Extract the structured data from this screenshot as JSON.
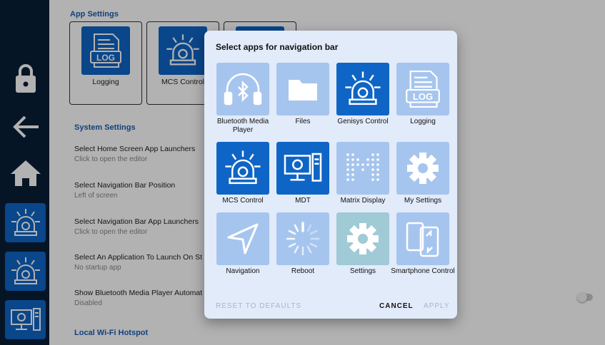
{
  "navbar": {
    "items": [
      {
        "name": "lock",
        "icon": "lock-icon"
      },
      {
        "name": "back",
        "icon": "arrow-left-icon"
      },
      {
        "name": "home",
        "icon": "home-icon"
      },
      {
        "name": "app-1",
        "icon": "beacon-icon"
      },
      {
        "name": "app-2",
        "icon": "beacon-icon"
      },
      {
        "name": "app-3",
        "icon": "computer-icon"
      }
    ]
  },
  "page": {
    "app_settings_header": "App Settings",
    "tiles": [
      {
        "label": "Logging",
        "icon": "log-icon"
      },
      {
        "label": "MCS Control",
        "icon": "beacon-icon"
      }
    ],
    "system_settings_header": "System Settings",
    "settings": [
      {
        "title": "Select Home Screen App Launchers",
        "subtitle": "Click to open the editor"
      },
      {
        "title": "Select Navigation Bar Position",
        "subtitle": "Left of screen"
      },
      {
        "title": "Select Navigation Bar App Launchers",
        "subtitle": "Click to open the editor"
      },
      {
        "title": "Select An Application To Launch On St",
        "subtitle": "No startup app"
      },
      {
        "title": "Show Bluetooth Media Player Automat",
        "subtitle": "Disabled"
      }
    ],
    "wifi_header": "Local Wi-Fi Hotspot"
  },
  "dialog": {
    "title": "Select apps for navigation bar",
    "apps": [
      {
        "label": "Bluetooth Media Player",
        "icon": "bluetooth-headphones-icon",
        "selected": false
      },
      {
        "label": "Files",
        "icon": "folder-icon",
        "selected": false
      },
      {
        "label": "Genisys Control",
        "icon": "beacon-icon",
        "selected": true
      },
      {
        "label": "Logging",
        "icon": "log-icon",
        "selected": false
      },
      {
        "label": "MCS Control",
        "icon": "beacon-icon",
        "selected": true
      },
      {
        "label": "MDT",
        "icon": "computer-icon",
        "selected": true
      },
      {
        "label": "Matrix Display",
        "icon": "matrix-dots-icon",
        "selected": false
      },
      {
        "label": "My Settings",
        "icon": "gear-icon",
        "selected": false
      },
      {
        "label": "Navigation",
        "icon": "navigation-arrow-icon",
        "selected": false
      },
      {
        "label": "Reboot",
        "icon": "reboot-spinner-icon",
        "selected": false
      },
      {
        "label": "Settings",
        "icon": "gear-icon",
        "selected": false
      },
      {
        "label": "Smartphone Control",
        "icon": "smartphone-icon",
        "selected": false
      }
    ],
    "reset_label": "RESET TO DEFAULTS",
    "cancel_label": "CANCEL",
    "apply_label": "APPLY"
  },
  "colors": {
    "navbar_bg": "#0a1f37",
    "selected_app": "#0f65c6",
    "unselected_app": "#a6c5ee",
    "dialog_bg": "#e2ebfa",
    "section_header": "#1a5db5"
  }
}
